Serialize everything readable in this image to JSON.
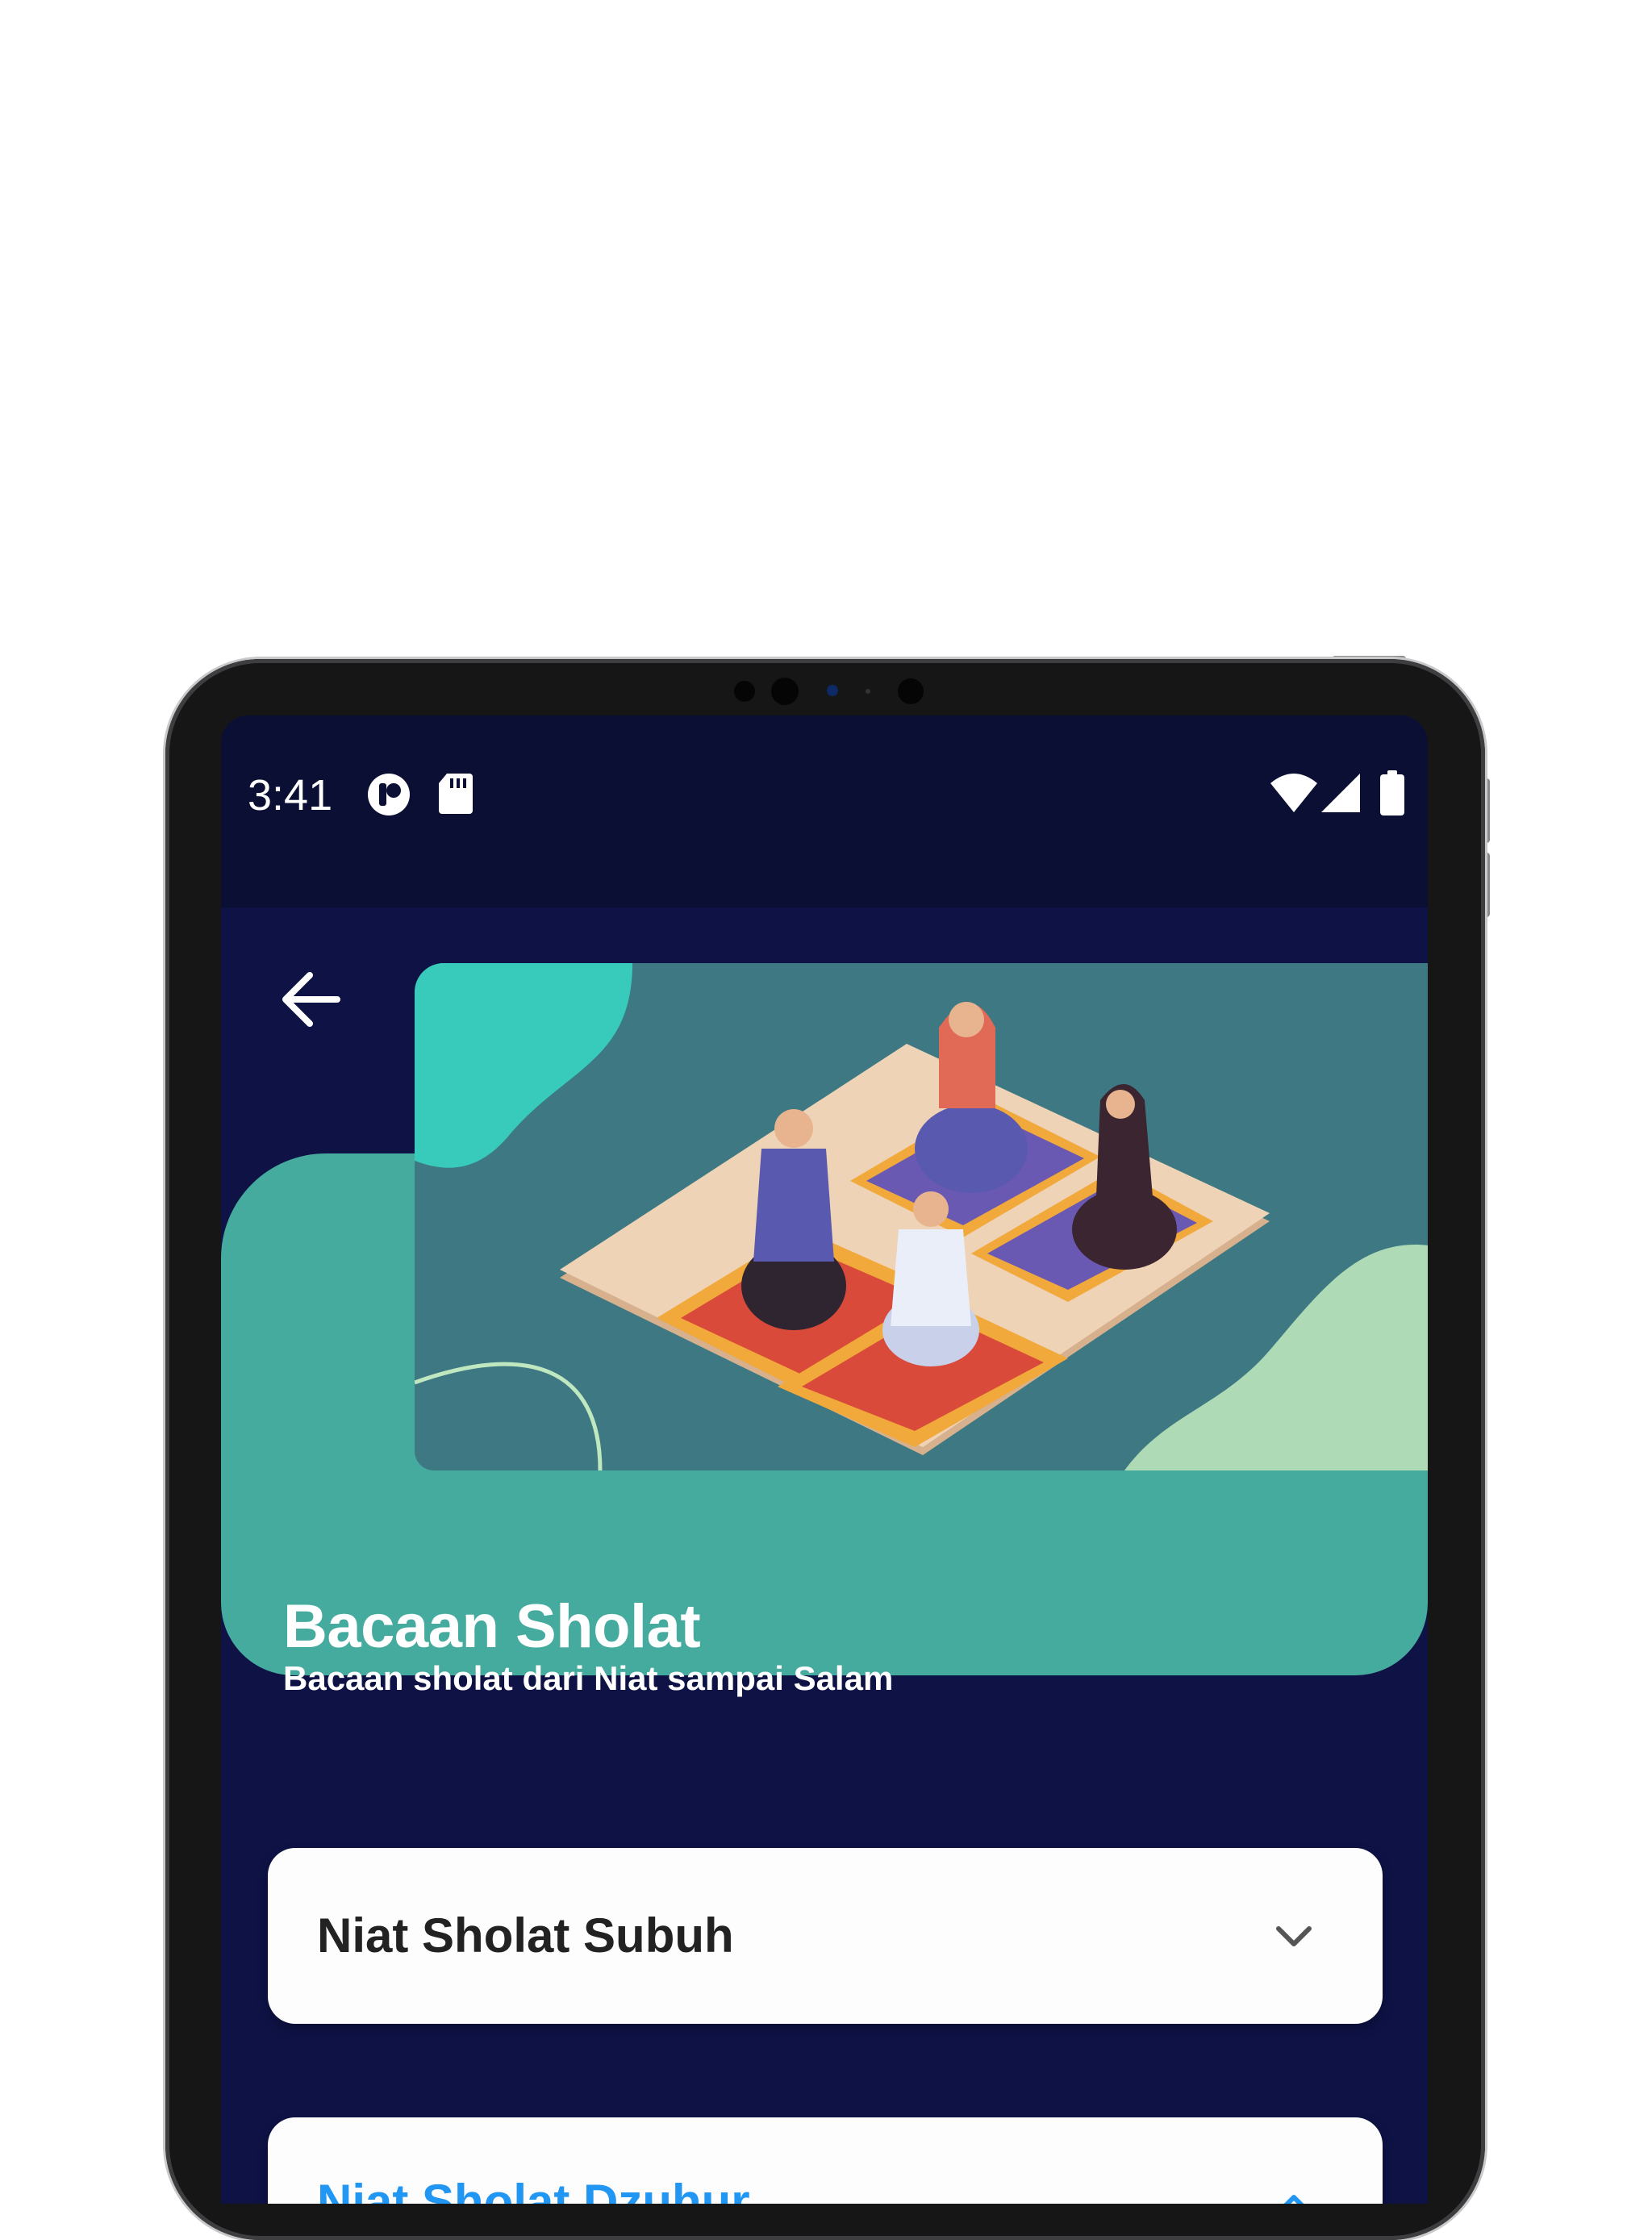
{
  "status_bar": {
    "time": "3:41",
    "left_icons": [
      "app-notification-icon",
      "sd-card-icon"
    ],
    "right_icons": [
      "wifi-icon",
      "cellular-signal-icon",
      "battery-icon"
    ]
  },
  "header": {
    "back_icon": "arrow-left-icon",
    "title": "Bacaan Sholat",
    "subtitle": "Bacaan sholat dari Niat sampai Salam"
  },
  "accordion": [
    {
      "label": "Niat Sholat Subuh",
      "expanded": false,
      "icon": "chevron-down-icon",
      "color": "#222222"
    },
    {
      "label": "Niat Sholat Dzuhur",
      "expanded": true,
      "icon": "chevron-up-icon",
      "color": "#2196f3"
    }
  ],
  "colors": {
    "background": "#0e1245",
    "status_bar": "#0a0f33",
    "hero": "#46ab9f",
    "illustration_bg": "#3e7882",
    "accent": "#2196f3"
  }
}
